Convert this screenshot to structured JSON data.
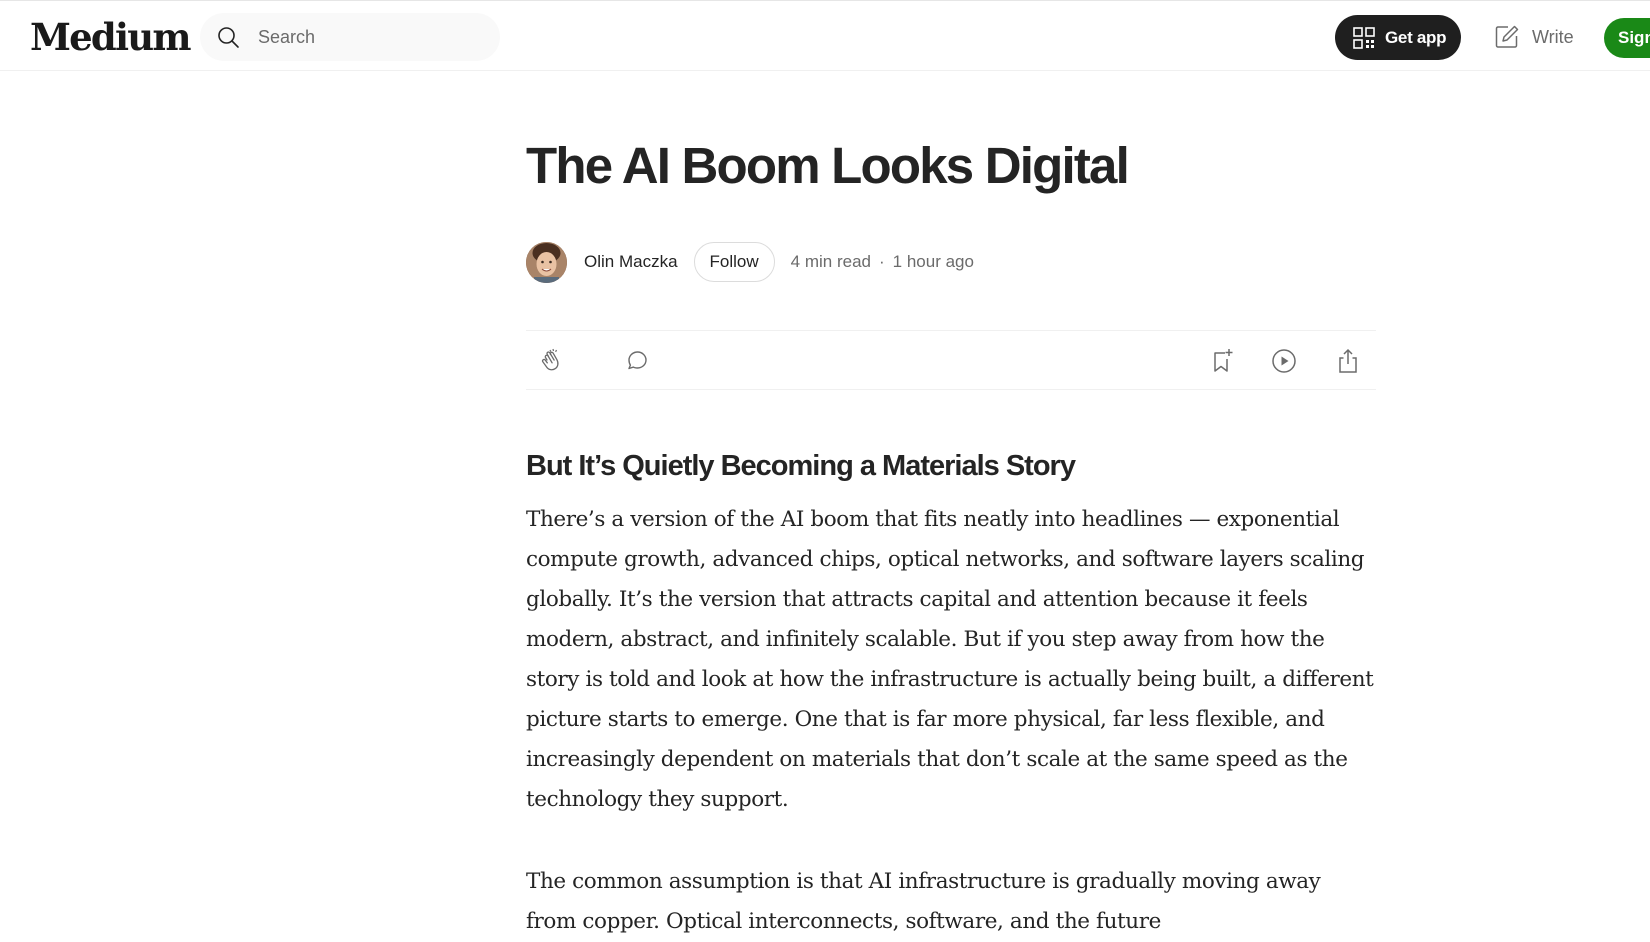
{
  "header": {
    "logo": "Medium",
    "search_placeholder": "Search",
    "get_app_label": "Get app",
    "write_label": "Write",
    "signup_label": "Sign up"
  },
  "article": {
    "title": "The AI Boom Looks Digital",
    "author": "Olin Maczka",
    "follow_label": "Follow",
    "read_time": "4 min read",
    "separator": "·",
    "published": "1 hour ago",
    "subtitle": "But It’s Quietly Becoming a Materials Story",
    "paragraphs": [
      "There’s a version of the AI boom that fits neatly into headlines — exponential compute growth, advanced chips, optical networks, and software layers scaling globally. It’s the version that attracts capital and attention because it feels modern, abstract, and infinitely scalable. But if you step away from how the story is told and look at how the infrastructure is actually being built, a different picture starts to emerge. One that is far more physical, far less flexible, and increasingly dependent on materials that don’t scale at the same speed as the technology they support.",
      "The common assumption is that AI infrastructure is gradually moving away from copper. Optical interconnects, software, and the future"
    ]
  },
  "icons": {
    "search": "search-icon",
    "get_app": "qr-code-icon",
    "write": "write-icon",
    "clap": "clap-icon",
    "comment": "comment-icon",
    "bookmark": "bookmark-add-icon",
    "listen": "play-icon",
    "share": "share-icon"
  },
  "colors": {
    "text": "#242424",
    "muted": "#6b6b6b",
    "signup_bg": "#1a8917",
    "get_app_bg": "#1f1f1f"
  }
}
